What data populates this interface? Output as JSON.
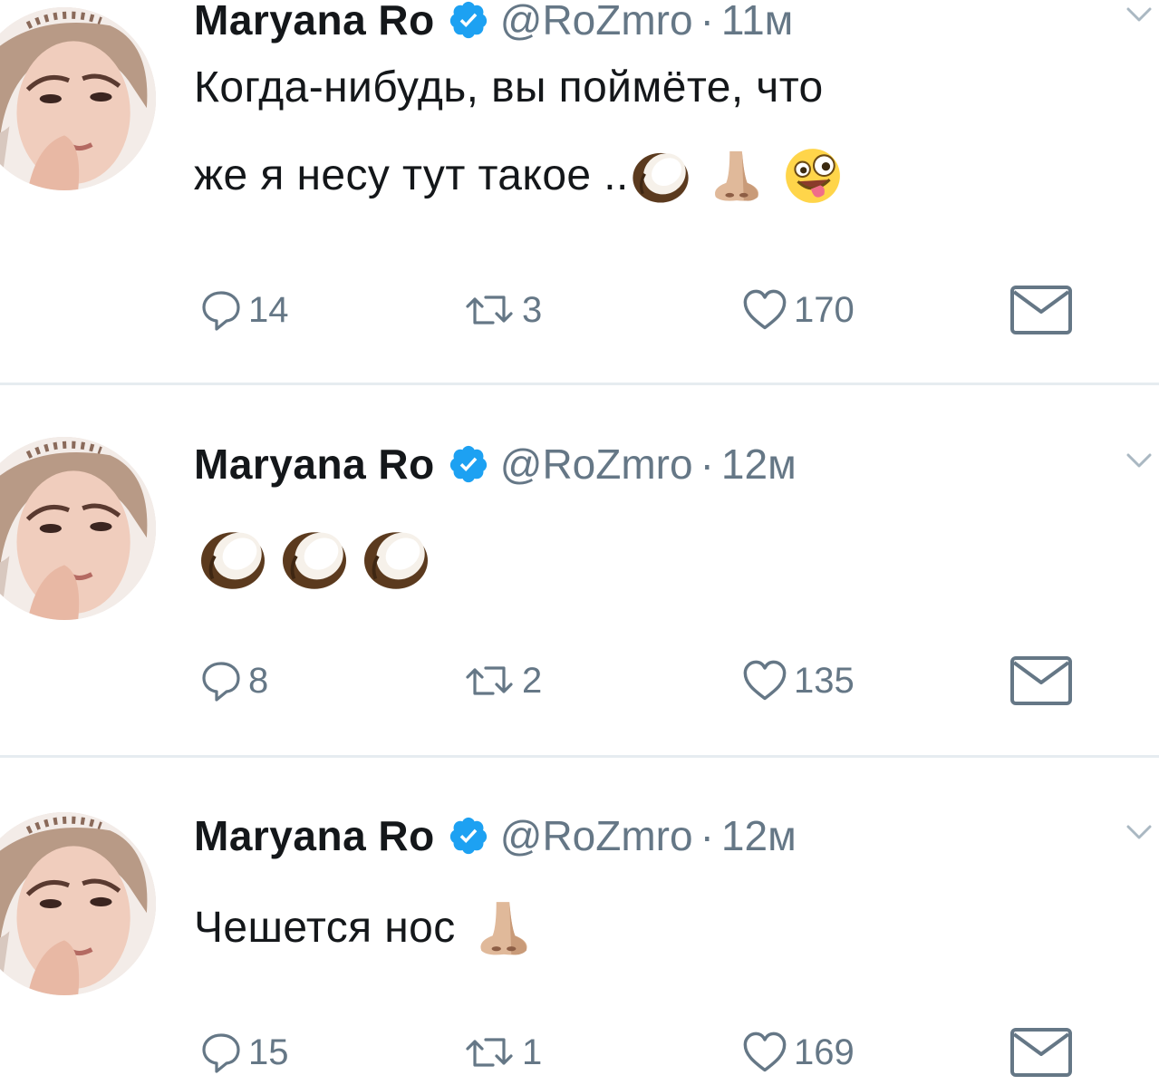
{
  "tweets": [
    {
      "name": "Maryana Ro",
      "handle": "@RoZmro",
      "dot": "·",
      "time": "11м",
      "text_line1": "Когда-нибудь, вы поймёте, что",
      "text_line2": "же я несу тут такое ..",
      "emojis": [
        "coconut-emoji",
        "nose-emoji",
        "zany-face-emoji"
      ],
      "replies": "14",
      "retweets": "3",
      "likes": "170"
    },
    {
      "name": "Maryana Ro",
      "handle": "@RoZmro",
      "dot": "·",
      "time": "12м",
      "text": "",
      "emojis": [
        "coconut-emoji",
        "coconut-emoji",
        "coconut-emoji"
      ],
      "replies": "8",
      "retweets": "2",
      "likes": "135"
    },
    {
      "name": "Maryana Ro",
      "handle": "@RoZmro",
      "dot": "·",
      "time": "12м",
      "text": "Чешется нос",
      "emojis": [
        "nose-emoji"
      ],
      "replies": "15",
      "retweets": "1",
      "likes": "169"
    }
  ],
  "colors": {
    "verified": "#1da1f2",
    "secondary_text": "#657786",
    "divider": "#e6ecf0"
  },
  "icons": [
    "reply-icon",
    "retweet-icon",
    "like-icon",
    "dm-icon",
    "verified-badge-icon",
    "chevron-down-icon"
  ]
}
